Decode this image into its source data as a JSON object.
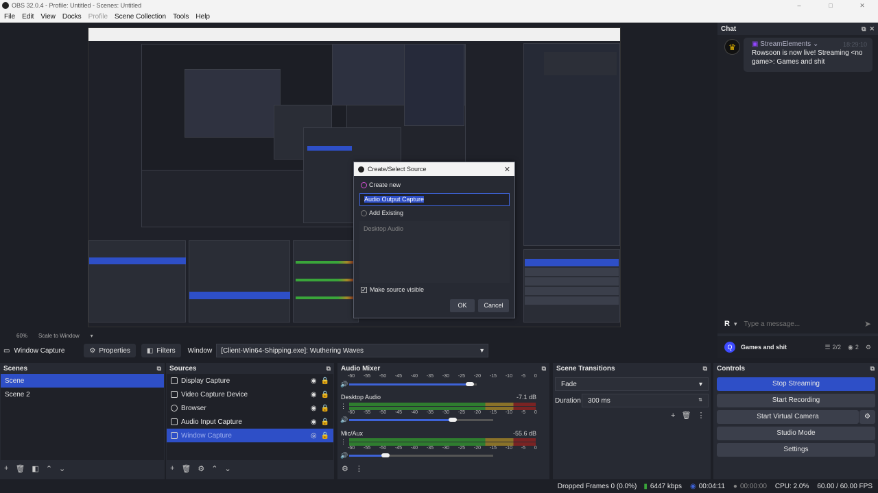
{
  "window": {
    "title": "OBS 32.0.4 - Profile: Untitled - Scenes: Untitled",
    "minimize": "–",
    "maximize": "□",
    "close": "✕"
  },
  "menu": [
    "File",
    "Edit",
    "View",
    "Docks",
    "Profile",
    "Scene Collection",
    "Tools",
    "Help"
  ],
  "menu_disabled": [
    "Profile"
  ],
  "dialog": {
    "title": "Create/Select Source",
    "create_new": "Create new",
    "name_value": "Audio Output Capture",
    "add_existing": "Add Existing",
    "existing_item": "Desktop Audio",
    "make_visible": "Make source visible",
    "ok": "OK",
    "cancel": "Cancel"
  },
  "chat": {
    "title": "Chat",
    "author": "StreamElements",
    "time": "18:29:10",
    "message": "Rowsoon is now live! Streaming <no game>: Games and shit",
    "input_placeholder": "Type a message...",
    "user_initial": "R",
    "channel": "Games and shit",
    "mods": "2/2",
    "viewers": "2"
  },
  "zoom": {
    "level": "60%",
    "mode": "Scale to Window"
  },
  "context": {
    "source": "Window Capture",
    "properties": "Properties",
    "filters": "Filters",
    "window_label": "Window",
    "window_value": "[Client-Win64-Shipping.exe]: Wuthering Waves"
  },
  "scenes": {
    "title": "Scenes",
    "items": [
      "Scene",
      "Scene 2"
    ]
  },
  "sources": {
    "title": "Sources",
    "items": [
      "Display Capture",
      "Video Capture Device",
      "Browser",
      "Audio Input Capture",
      "Window Capture"
    ]
  },
  "mixer": {
    "title": "Audio Mixer",
    "scale": [
      "-60",
      "-55",
      "-50",
      "-45",
      "-40",
      "-35",
      "-30",
      "-25",
      "-20",
      "-15",
      "-10",
      "-5",
      "0"
    ],
    "tracks": [
      {
        "name": "Desktop Audio",
        "db": "-7.1 dB",
        "volume": 0.72
      },
      {
        "name": "Mic/Aux",
        "db": "-55.6 dB",
        "volume": 0.25
      }
    ]
  },
  "transitions": {
    "title": "Scene Transitions",
    "type": "Fade",
    "duration_label": "Duration",
    "duration": "300 ms"
  },
  "controls": {
    "title": "Controls",
    "stop_streaming": "Stop Streaming",
    "start_recording": "Start Recording",
    "start_virtual_camera": "Start Virtual Camera",
    "studio_mode": "Studio Mode",
    "settings": "Settings"
  },
  "status": {
    "dropped": "Dropped Frames 0 (0.0%)",
    "bitrate": "6447 kbps",
    "stream_time": "00:04:11",
    "rec_time": "00:00:00",
    "cpu": "CPU: 2.0%",
    "fps": "60.00 / 60.00 FPS"
  },
  "colors": {
    "accent": "#2e4fc7",
    "panel": "#272a33",
    "background": "#1d1f26"
  }
}
